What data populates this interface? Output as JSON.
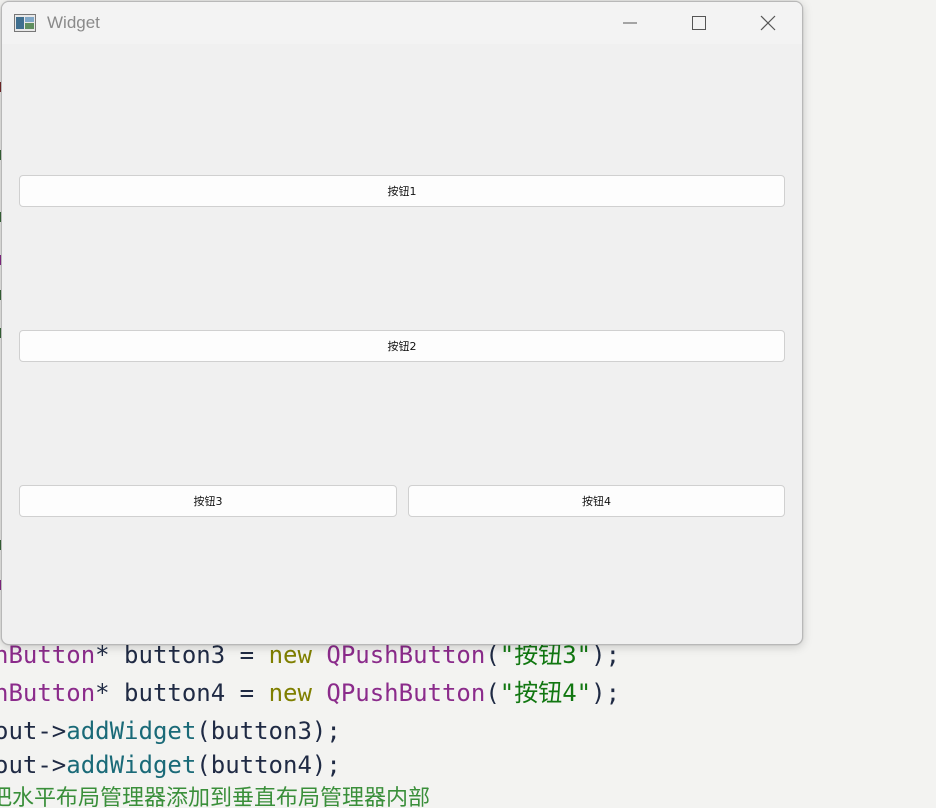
{
  "window": {
    "title": "Widget",
    "buttons": {
      "button1": "按钮1",
      "button2": "按钮2",
      "button3": "按钮3",
      "button4": "按钮4"
    }
  },
  "editor": {
    "line1": {
      "type": "nButton",
      "star": "*",
      "var": " button3 = ",
      "kw": "new",
      "cls": " QPushButton",
      "open": "(",
      "str": "\"按钮3\"",
      "close": ");"
    },
    "line2": {
      "type": "nButton",
      "star": "*",
      "var": " button4 = ",
      "kw": "new",
      "cls": " QPushButton",
      "open": "(",
      "str": "\"按钮4\"",
      "close": ");"
    },
    "line3": {
      "obj": "out->",
      "fn": "addWidget",
      "args": "(button3);"
    },
    "line4": {
      "obj": "out->",
      "fn": "addWidget",
      "args": "(button4);"
    },
    "line5": "把水平布局管理器添加到垂直布局管理器内部"
  }
}
